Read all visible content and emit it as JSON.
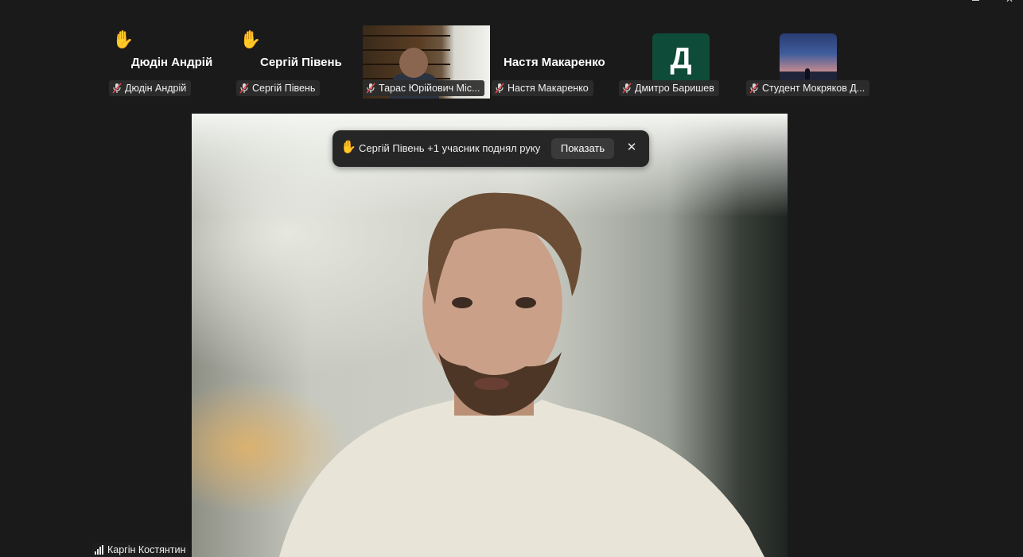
{
  "participants": [
    {
      "display_name": "Дюдін Андрій",
      "label": "Дюдін Андрій",
      "hand_raised": true,
      "muted": true,
      "tile": "name"
    },
    {
      "display_name": "Сергій Півень",
      "label": "Сергій Півень",
      "hand_raised": true,
      "muted": true,
      "tile": "name"
    },
    {
      "display_name": "",
      "label": "Тарас Юрійович Міс...",
      "hand_raised": false,
      "muted": true,
      "tile": "video"
    },
    {
      "display_name": "Настя Макаренко",
      "label": "Настя Макаренко",
      "hand_raised": false,
      "muted": true,
      "tile": "name"
    },
    {
      "display_name": "Д",
      "label": "Дмитро Баришев",
      "hand_raised": false,
      "muted": true,
      "tile": "avatar-letter",
      "avatar_color": "#0e4b38"
    },
    {
      "display_name": "",
      "label": "Студент Мокряков Д...",
      "hand_raised": false,
      "muted": true,
      "tile": "avatar-image"
    }
  ],
  "notification": {
    "icon": "raised-hand-icon",
    "text": "Сергій Півень +1 учасник поднял руку",
    "button_label": "Показать",
    "close_label": "✕"
  },
  "active_speaker": {
    "name": "Каргін Костянтин",
    "icon": "signal-bars-icon"
  },
  "colors": {
    "background": "#1a1a1a",
    "hand": "#f4c34a",
    "muted_mic": "#e0474c",
    "toast_bg": "#262626"
  }
}
